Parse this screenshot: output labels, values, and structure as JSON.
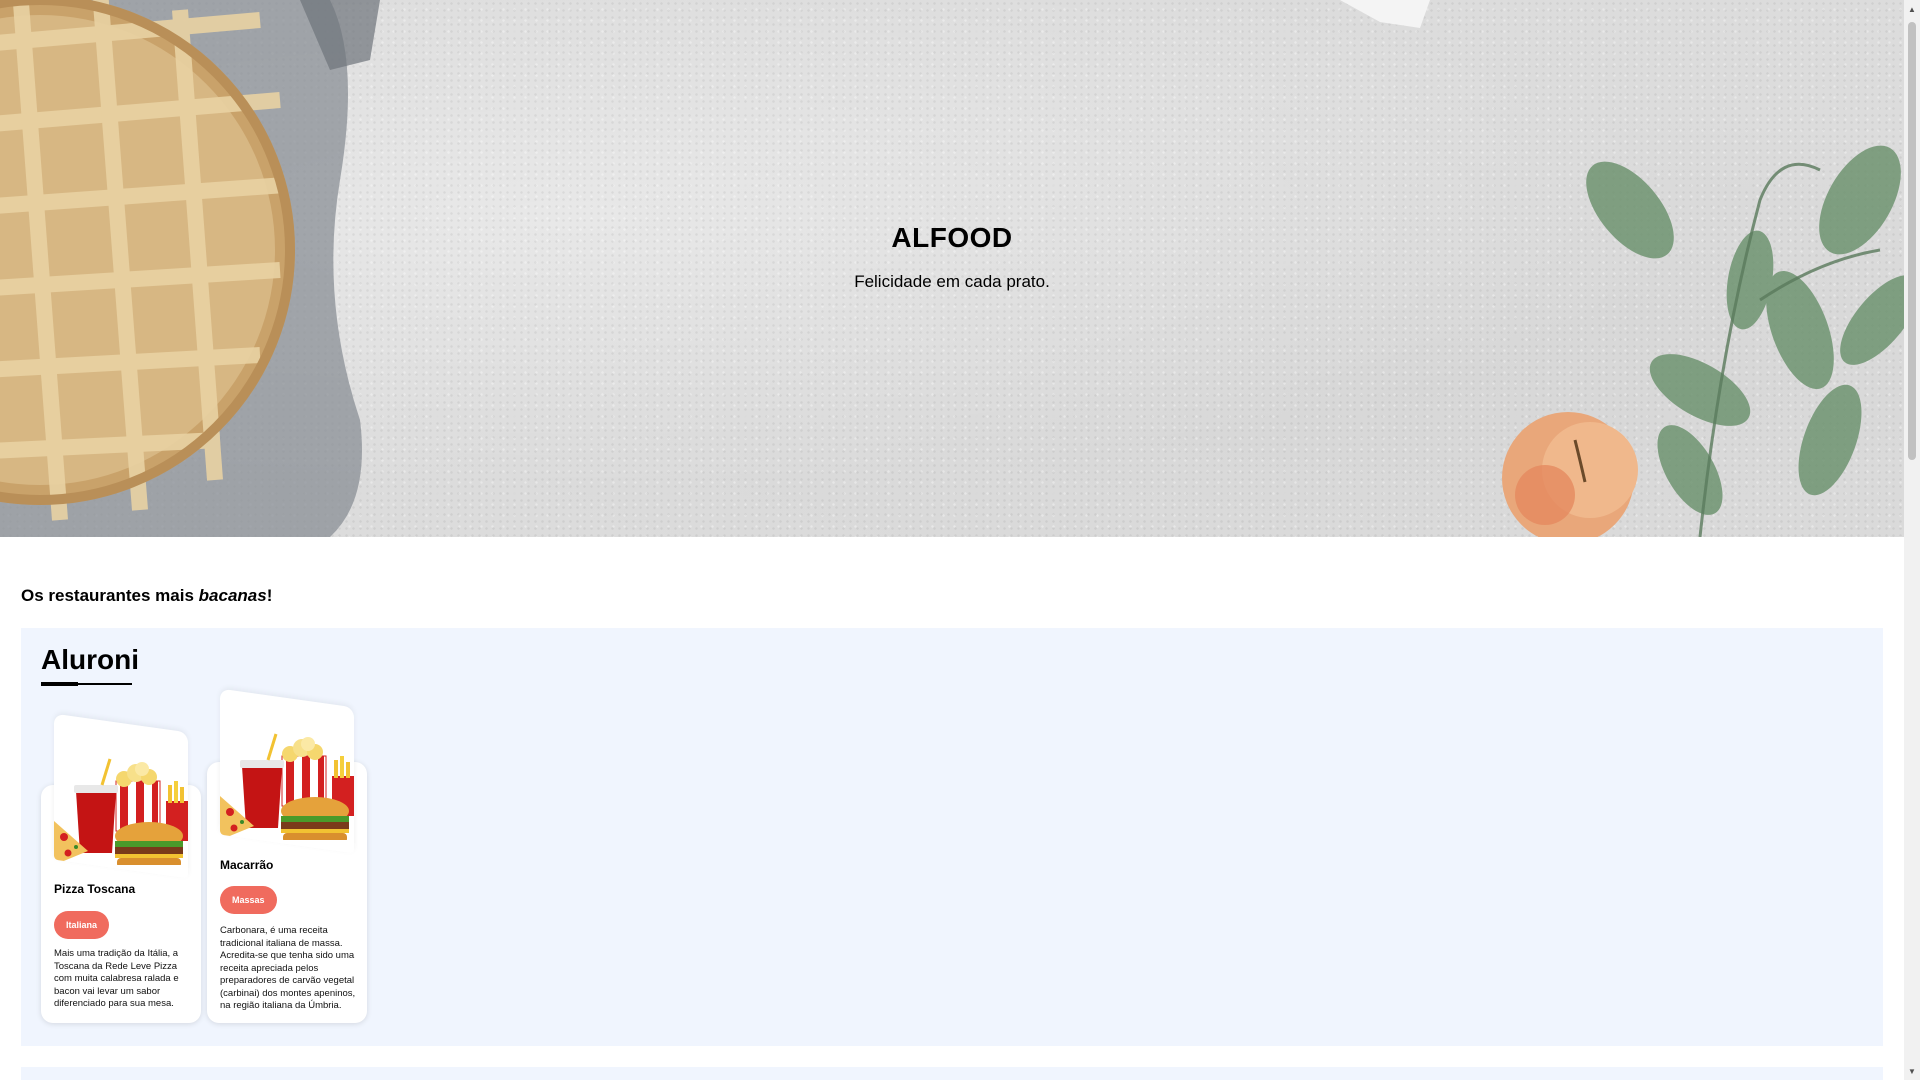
{
  "hero": {
    "title": "ALFOOD",
    "subtitle": "Felicidade em cada prato."
  },
  "section": {
    "heading_prefix": "Os restaurantes mais ",
    "heading_emphasis": "bacanas",
    "heading_suffix": "!"
  },
  "restaurants": [
    {
      "name": "Aluroni",
      "dishes": [
        {
          "name": "Pizza Toscana",
          "tag": "Italiana",
          "description": "Mais uma tradição da Itália, a Toscana da Rede Leve Pizza com muita calabresa ralada e bacon vai levar um sabor diferenciado para sua mesa."
        },
        {
          "name": "Macarrão",
          "tag": "Massas",
          "description": "Carbonara, é uma receita tradicional italiana de massa. Acredita-se que tenha sido uma receita apreciada pelos preparadores de carvão vegetal (carbinai) dos montes apeninos, na região italiana da Úmbria."
        }
      ]
    }
  ],
  "colors": {
    "tag_background": "#f06b5e",
    "restaurant_panel": "#f0f5fe",
    "hero_background": "#dcdcdc"
  },
  "icons": {
    "dish_image": "fast-food-illustration",
    "scroll_up": "triangle-up-icon",
    "scroll_down": "triangle-down-icon"
  }
}
